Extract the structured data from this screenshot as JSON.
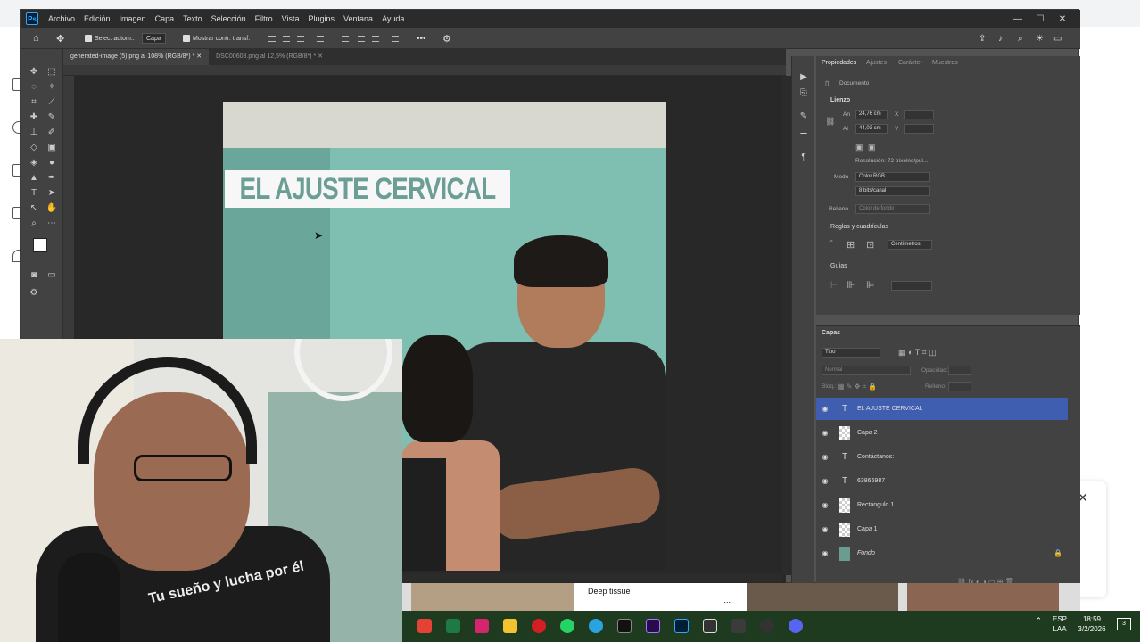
{
  "menubar": {
    "items": [
      "Archivo",
      "Edición",
      "Imagen",
      "Capa",
      "Texto",
      "Selección",
      "Filtro",
      "Vista",
      "Plugins",
      "Ventana",
      "Ayuda"
    ]
  },
  "options": {
    "autoselect_label": "Selec. autom.:",
    "autoselect_value": "Capa",
    "transform_label": "Mostrar contr. transf."
  },
  "tabs": [
    {
      "label": "generated-image (5).png al 108% (RGB/8*) *"
    },
    {
      "label": "DSC00608.png al 12,5% (RGB/8*) *"
    }
  ],
  "canvas": {
    "title_text": "EL AJUSTE CERVICAL"
  },
  "properties": {
    "tabs": [
      "Propiedades",
      "Ajustes",
      "Carácter",
      "Muestras"
    ],
    "doc_label": "Documento",
    "lienzo": "Lienzo",
    "w_label": "An",
    "w_value": "24,76 cm",
    "h_label": "Al",
    "h_value": "44,03 cm",
    "x_label": "X",
    "y_label": "Y",
    "resolution": "Resolución: 72 píxeles/pul...",
    "mode_label": "Modo",
    "mode_value": "Color RGB",
    "bits_value": "8 bits/canal",
    "fill_label": "Relleno",
    "fill_value": "Color de fondo",
    "rulers_section": "Reglas y cuadrículas",
    "units_value": "Centímetros",
    "guides_section": "Guías"
  },
  "layers": {
    "panel_title": "Capas",
    "filter_value": "Tipo",
    "blend_value": "Normal",
    "opacity_label": "Opacidad:",
    "lock_label": "Bloq.:",
    "fill_label": "Relleno:",
    "items": [
      {
        "name": "EL AJUSTE CERVICAL",
        "kind": "text",
        "selected": true
      },
      {
        "name": "Capa 2",
        "kind": "image",
        "selected": false
      },
      {
        "name": "Contáctanos:",
        "kind": "text",
        "selected": false
      },
      {
        "name": "63866987",
        "kind": "text",
        "selected": false
      },
      {
        "name": "Rectángulo 1",
        "kind": "image",
        "selected": false
      },
      {
        "name": "Capa 1",
        "kind": "image",
        "selected": false
      },
      {
        "name": "Fondo",
        "kind": "photo",
        "selected": false
      }
    ]
  },
  "webcam": {
    "shirt_text": "Tu sueño y lucha por él"
  },
  "taskbar": {
    "lang": "ESP",
    "lang2": "LAA",
    "time": "18:59",
    "date": "3/2/2026",
    "notif_count": "3"
  },
  "overlay": {
    "card_title": "Deep tissue",
    "card_more": "..."
  },
  "colors": {
    "ps_bg": "#535353",
    "selected_layer": "#3f5eb0",
    "wall_teal": "#7fbfb1",
    "title_teal": "#6b9e95"
  }
}
